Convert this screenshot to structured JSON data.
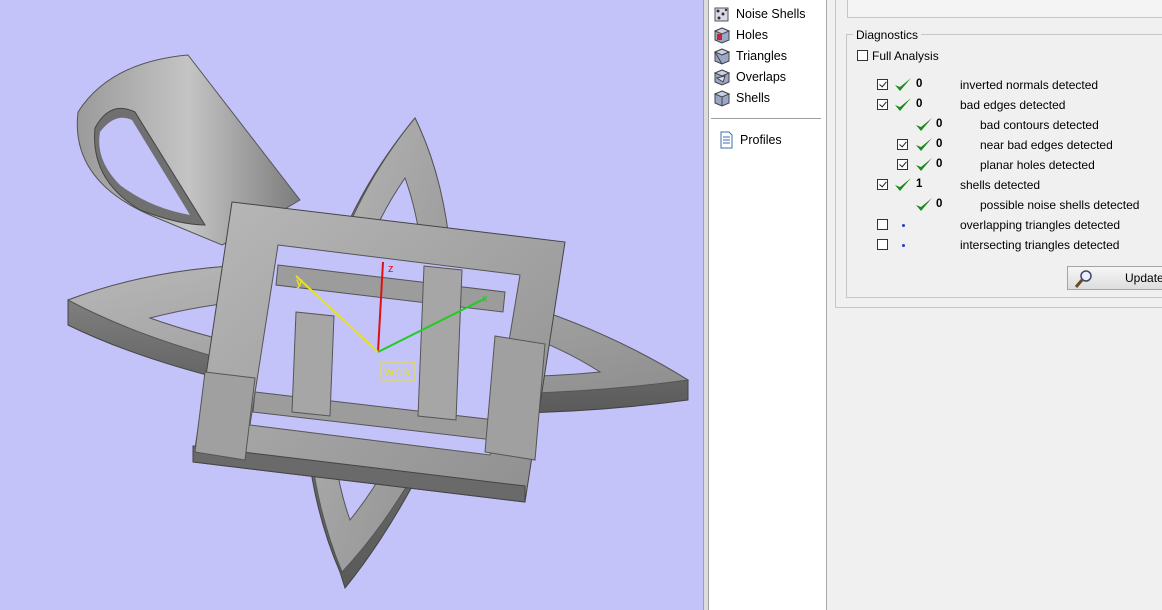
{
  "tree": {
    "items": [
      {
        "label": "Noise Shells",
        "icon": "noise-shells-icon"
      },
      {
        "label": "Holes",
        "icon": "holes-icon"
      },
      {
        "label": "Triangles",
        "icon": "triangles-icon"
      },
      {
        "label": "Overlaps",
        "icon": "overlaps-icon"
      },
      {
        "label": "Shells",
        "icon": "shells-icon"
      }
    ],
    "profiles_label": "Profiles"
  },
  "viewport": {
    "axis_labels": {
      "x": "x",
      "y": "y",
      "z": "z"
    },
    "wcs_label": "WCS",
    "colors": {
      "background": "#c3c3f9",
      "x_axis": "#22cc22",
      "y_axis": "#e8e020",
      "z_axis": "#dd1111"
    }
  },
  "diagnostics": {
    "title": "Diagnostics",
    "full_analysis": {
      "label": "Full Analysis",
      "checked": false
    },
    "rows": [
      {
        "checked": true,
        "status": "ok",
        "count": "0",
        "label": "inverted normals detected"
      },
      {
        "checked": true,
        "status": "ok",
        "count": "0",
        "label": "bad edges detected"
      },
      {
        "checked": null,
        "status": "ok",
        "count": "0",
        "label": "bad contours detected"
      },
      {
        "checked": true,
        "status": "ok",
        "count": "0",
        "label": "near bad edges detected"
      },
      {
        "checked": true,
        "status": "ok",
        "count": "0",
        "label": "planar holes detected"
      },
      {
        "checked": true,
        "status": "ok",
        "count": "1",
        "label": "shells detected"
      },
      {
        "checked": null,
        "status": "ok",
        "count": "0",
        "label": "possible noise shells detected"
      },
      {
        "checked": false,
        "status": "pending",
        "count": "",
        "label": "overlapping triangles detected"
      },
      {
        "checked": false,
        "status": "pending",
        "count": "",
        "label": "intersecting triangles detected"
      }
    ],
    "update_label": "Update"
  }
}
